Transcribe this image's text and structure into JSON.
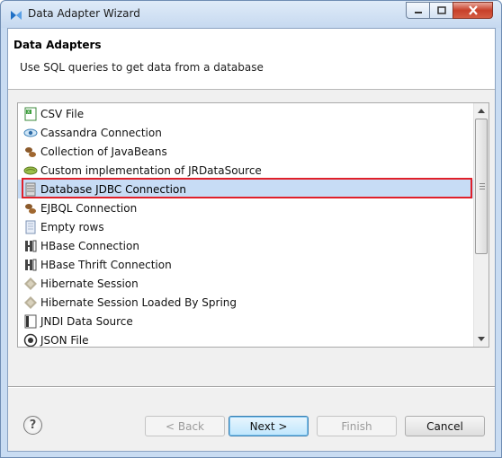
{
  "window": {
    "title": "Data Adapter Wizard"
  },
  "header": {
    "title": "Data Adapters",
    "description": "Use SQL queries to get data from a database"
  },
  "adapters": [
    {
      "label": "CSV File",
      "icon": "csv-file-icon"
    },
    {
      "label": "Cassandra Connection",
      "icon": "cassandra-eye-icon"
    },
    {
      "label": "Collection of JavaBeans",
      "icon": "javabeans-icon"
    },
    {
      "label": "Custom implementation of JRDataSource",
      "icon": "custom-bean-icon"
    },
    {
      "label": "Database JDBC Connection",
      "icon": "database-icon",
      "selected": true
    },
    {
      "label": "EJBQL Connection",
      "icon": "ejbql-beans-icon"
    },
    {
      "label": "Empty rows",
      "icon": "empty-rows-icon"
    },
    {
      "label": "HBase Connection",
      "icon": "hbase-icon"
    },
    {
      "label": "HBase Thrift Connection",
      "icon": "hbase-icon"
    },
    {
      "label": "Hibernate Session",
      "icon": "hibernate-icon"
    },
    {
      "label": "Hibernate Session Loaded By Spring",
      "icon": "hibernate-icon"
    },
    {
      "label": "JNDI Data Source",
      "icon": "jndi-icon"
    },
    {
      "label": "JSON File",
      "icon": "json-icon"
    }
  ],
  "buttons": {
    "back": "< Back",
    "next": "Next >",
    "finish": "Finish",
    "cancel": "Cancel",
    "help": "?"
  },
  "colors": {
    "selection": "#c7dcf5",
    "highlight_border": "#e0202a"
  }
}
